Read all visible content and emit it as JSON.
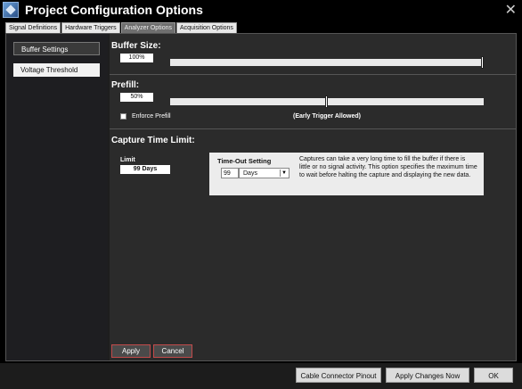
{
  "window": {
    "title": "Project Configuration Options"
  },
  "tabs": [
    {
      "label": "Signal Definitions"
    },
    {
      "label": "Hardware Triggers"
    },
    {
      "label": "Analyzer Options"
    },
    {
      "label": "Acquisition Options"
    }
  ],
  "active_tab_index": 2,
  "sidebar": {
    "items": [
      {
        "label": "Buffer Settings"
      },
      {
        "label": "Voltage Threshold"
      }
    ]
  },
  "buffer": {
    "heading": "Buffer Size:",
    "value": "100%",
    "slider_level": 1.0
  },
  "prefill": {
    "heading": "Prefill:",
    "value": "50%",
    "slider_level": 0.5,
    "enforce_label": "Enforce Prefill",
    "enforce_checked": false,
    "note": "(Early Trigger Allowed)"
  },
  "capture": {
    "heading": "Capture Time Limit:",
    "limit_label": "Limit",
    "limit_value": "99 Days",
    "timeout_label": "Time-Out Setting",
    "timeout_number": "99",
    "timeout_unit": "Days",
    "description": "Captures can take a very long time to fill the buffer if there is little or no signal activity. This option specifies the maximum time to wait before halting the capture and displaying the new data."
  },
  "content_buttons": {
    "apply": "Apply",
    "cancel": "Cancel"
  },
  "footer": {
    "cable_pinout": "Cable Connector Pinout",
    "apply_changes": "Apply Changes Now",
    "ok": "OK"
  },
  "colors": {
    "accent_red": "#c24a4a",
    "background": "#000000"
  }
}
